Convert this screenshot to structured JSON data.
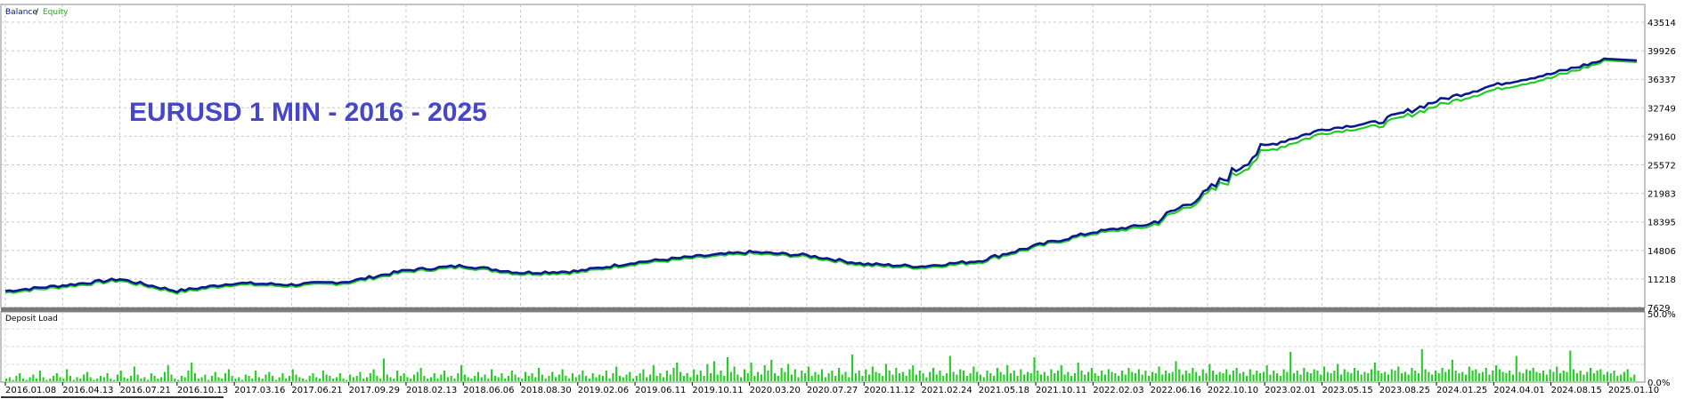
{
  "chart_data": [
    {
      "type": "line",
      "legend": [
        "Balance",
        "Equity"
      ],
      "legend_separator": "/",
      "overlay_title": "EURUSD 1 MIN - 2016 - 2025",
      "colors": {
        "balance": "#0a1a8c",
        "equity": "#22cc22",
        "overlay": "#4646c8"
      },
      "y_ticks": [
        43514,
        39926,
        36337,
        32749,
        29160,
        25572,
        21983,
        18395,
        14806,
        11218,
        7629
      ],
      "ylim": [
        7629,
        43514
      ],
      "x_ticks": [
        "2016.01.08",
        "2016.04.13",
        "2016.07.21",
        "2016.10.13",
        "2017.03.16",
        "2017.06.21",
        "2017.09.29",
        "2018.02.13",
        "2018.06.06",
        "2018.08.30",
        "2019.02.06",
        "2019.06.11",
        "2019.10.11",
        "2020.03.20",
        "2020.07.27",
        "2020.11.12",
        "2021.02.24",
        "2021.05.18",
        "2021.10.11",
        "2022.02.03",
        "2022.06.16",
        "2022.10.10",
        "2023.02.01",
        "2023.05.15",
        "2023.08.25",
        "2024.01.25",
        "2024.04.01",
        "2024.08.15",
        "2025.01.10"
      ],
      "x": [
        "2016.01.08",
        "2016.04.13",
        "2016.07.21",
        "2016.10.13",
        "2017.03.16",
        "2017.06.21",
        "2017.09.29",
        "2018.02.13",
        "2018.06.06",
        "2018.08.30",
        "2019.02.06",
        "2019.06.11",
        "2019.10.11",
        "2020.03.20",
        "2020.07.27",
        "2020.11.12",
        "2021.02.24",
        "2021.05.18",
        "2021.10.11",
        "2022.02.03",
        "2022.06.16",
        "2022.10.10",
        "2023.02.01",
        "2023.05.15",
        "2023.08.25",
        "2024.01.25",
        "2024.04.01",
        "2024.08.15",
        "2025.01.10"
      ],
      "series": [
        {
          "name": "Balance",
          "values": [
            9700,
            10400,
            11200,
            9700,
            10700,
            10500,
            10900,
            12300,
            12900,
            12000,
            12200,
            13300,
            14000,
            14600,
            14200,
            13100,
            12800,
            13500,
            15400,
            17100,
            18100,
            22100,
            27900,
            30000,
            31000,
            33600,
            35600,
            37000,
            38900
          ]
        },
        {
          "name": "Equity",
          "values": [
            9500,
            10200,
            11000,
            9500,
            10500,
            10300,
            10700,
            12100,
            12700,
            11800,
            12000,
            13100,
            13800,
            14400,
            14000,
            12900,
            12600,
            13300,
            15200,
            16900,
            17800,
            21700,
            27200,
            29500,
            30500,
            33000,
            35000,
            36500,
            38700
          ]
        }
      ],
      "grid": true
    },
    {
      "type": "bar",
      "title": "Deposit Load",
      "y_ticks": [
        "50.0%",
        "0.0%"
      ],
      "ylim": [
        0,
        50
      ],
      "color": "#22cc22",
      "values": [
        2,
        3,
        1,
        4,
        6,
        2,
        1,
        3,
        5,
        2,
        8,
        3,
        1,
        2,
        4,
        6,
        3,
        2,
        9,
        4,
        1,
        3,
        2,
        5,
        7,
        3,
        1,
        2,
        4,
        3,
        6,
        2,
        1,
        5,
        8,
        3,
        2,
        4,
        11,
        5,
        2,
        3,
        1,
        6,
        4,
        2,
        3,
        7,
        12,
        5,
        2,
        1,
        4,
        3,
        8,
        14,
        6,
        2,
        3,
        5,
        1,
        4,
        7,
        3,
        2,
        6,
        9,
        4,
        2,
        3,
        1,
        5,
        4,
        2,
        8,
        3,
        2,
        5,
        7,
        4,
        1,
        3,
        6,
        2,
        4,
        9,
        5,
        3,
        2,
        1,
        4,
        6,
        3,
        2,
        8,
        5,
        4,
        2,
        3,
        6,
        2,
        1,
        5,
        3,
        4,
        7,
        2,
        3,
        6,
        9,
        4,
        2,
        17,
        5,
        3,
        2,
        8,
        4,
        6,
        3,
        2,
        5,
        7,
        10,
        4,
        2,
        3,
        6,
        2,
        5,
        8,
        3,
        4,
        2,
        6,
        12,
        5,
        3,
        2,
        4,
        7,
        3,
        5,
        2,
        9,
        4,
        3,
        6,
        2,
        4,
        8,
        5,
        3,
        2,
        7,
        4,
        6,
        3,
        10,
        5,
        2,
        4,
        7,
        3,
        5,
        9,
        4,
        2,
        6,
        3,
        5,
        8,
        4,
        2,
        6,
        3,
        5,
        4,
        8,
        2,
        6,
        11,
        4,
        3,
        5,
        7,
        2,
        4,
        6,
        9,
        3,
        5,
        12,
        4,
        6,
        3,
        8,
        5,
        10,
        14,
        7,
        4,
        6,
        3,
        9,
        5,
        8,
        4,
        13,
        6,
        15,
        5,
        8,
        4,
        18,
        7,
        11,
        5,
        3,
        9,
        6,
        14,
        4,
        7,
        5,
        12,
        8,
        16,
        6,
        4,
        10,
        7,
        13,
        5,
        9,
        3,
        8,
        6,
        11,
        4,
        7,
        5,
        9,
        3,
        6,
        8,
        4,
        10,
        5,
        7,
        3,
        20,
        6,
        8,
        4,
        9,
        5,
        11,
        7,
        6,
        4,
        13,
        8,
        5,
        10,
        6,
        7,
        4,
        9,
        12,
        5,
        8,
        6,
        3,
        7,
        10,
        5,
        8,
        4,
        6,
        19,
        7,
        5,
        9,
        8,
        4,
        6,
        11,
        7,
        5,
        3,
        8,
        6,
        4,
        10,
        7,
        5,
        12,
        6,
        8,
        4,
        9,
        5,
        7,
        6,
        18,
        8,
        5,
        7,
        4,
        9,
        6,
        8,
        12,
        5,
        7,
        4,
        6,
        14,
        8,
        5,
        7,
        10,
        6,
        4,
        8,
        5,
        9,
        7,
        6,
        4,
        8,
        5,
        10,
        7,
        6,
        9,
        5,
        8,
        4,
        7,
        6,
        11,
        5,
        8,
        6,
        7,
        15,
        9,
        5,
        8,
        6,
        10,
        7,
        4,
        9,
        6,
        13,
        8,
        5,
        7,
        6,
        9,
        5,
        8,
        10,
        6,
        7,
        4,
        9,
        5,
        8,
        6,
        7,
        12,
        5,
        8,
        6,
        4,
        9,
        7,
        22,
        6,
        8,
        5,
        10,
        7,
        6,
        9,
        8,
        5,
        11,
        7,
        6,
        8,
        13,
        5,
        9,
        7,
        6,
        10,
        8,
        5,
        7,
        6,
        9,
        14,
        8,
        6,
        7,
        5,
        9,
        8,
        11,
        6,
        7,
        5,
        10,
        8,
        6,
        24,
        9,
        7,
        5,
        8,
        6,
        10,
        7,
        9,
        16,
        8,
        6,
        7,
        5,
        11,
        8,
        9,
        6,
        7,
        10,
        5,
        8,
        12,
        9,
        7,
        6,
        8,
        5,
        19,
        7,
        6,
        9,
        8,
        10,
        7,
        6,
        8,
        5,
        9,
        7,
        11,
        6,
        8,
        7,
        23,
        9,
        6,
        8,
        5,
        7,
        10,
        6,
        8,
        9,
        5,
        7,
        6,
        8,
        4,
        5,
        7,
        9,
        3,
        5
      ]
    }
  ]
}
